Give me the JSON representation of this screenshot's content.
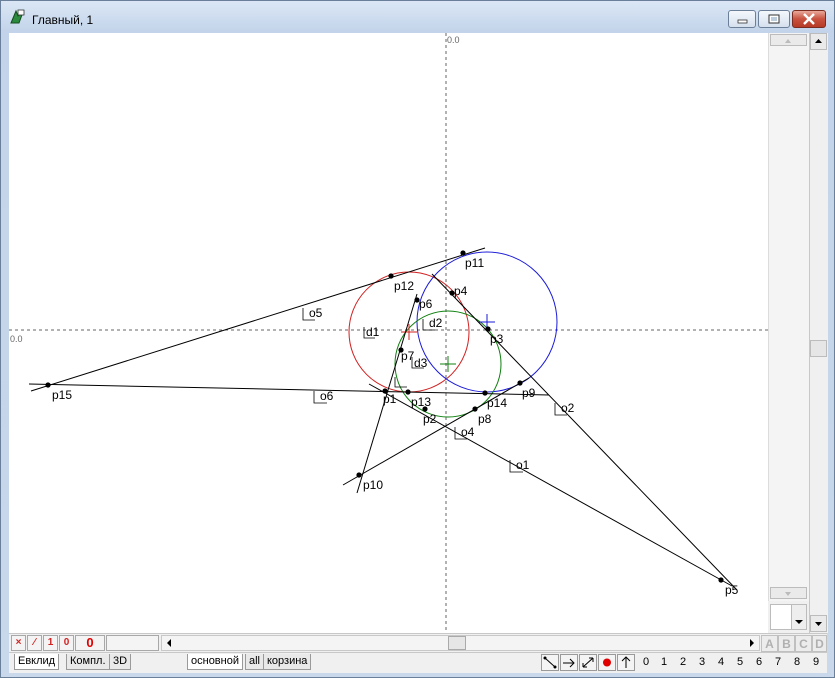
{
  "window": {
    "title": "Главный, 1"
  },
  "canvas": {
    "axis_x_label": "0.0",
    "axis_y_label": "0.0",
    "points": [
      {
        "name": "p1"
      },
      {
        "name": "p2"
      },
      {
        "name": "p3"
      },
      {
        "name": "p4"
      },
      {
        "name": "p5"
      },
      {
        "name": "p6"
      },
      {
        "name": "p7"
      },
      {
        "name": "p8"
      },
      {
        "name": "p9"
      },
      {
        "name": "p10"
      },
      {
        "name": "p11"
      },
      {
        "name": "p12"
      },
      {
        "name": "p13"
      },
      {
        "name": "p14"
      },
      {
        "name": "p15"
      }
    ],
    "line_labels": [
      "o1",
      "o2",
      "o4",
      "o5",
      "o6"
    ],
    "circle_labels": [
      "d1",
      "d2",
      "d3"
    ],
    "circle_colors": {
      "red": "#d02020",
      "blue": "#1a1ad8",
      "green": "#108010"
    }
  },
  "toolbar_left": {
    "delete_icon": "×",
    "line_icon": "∕",
    "one": "1",
    "zero_small": "0",
    "zero_big": "0"
  },
  "letters": [
    "A",
    "B",
    "C",
    "D"
  ],
  "bottom_tabs": [
    "Евклид",
    "Компл.",
    "3D"
  ],
  "layer_tabs": [
    "основной",
    "all",
    "корзина"
  ],
  "digits": [
    "0",
    "1",
    "2",
    "3",
    "4",
    "5",
    "6",
    "7",
    "8",
    "9"
  ]
}
